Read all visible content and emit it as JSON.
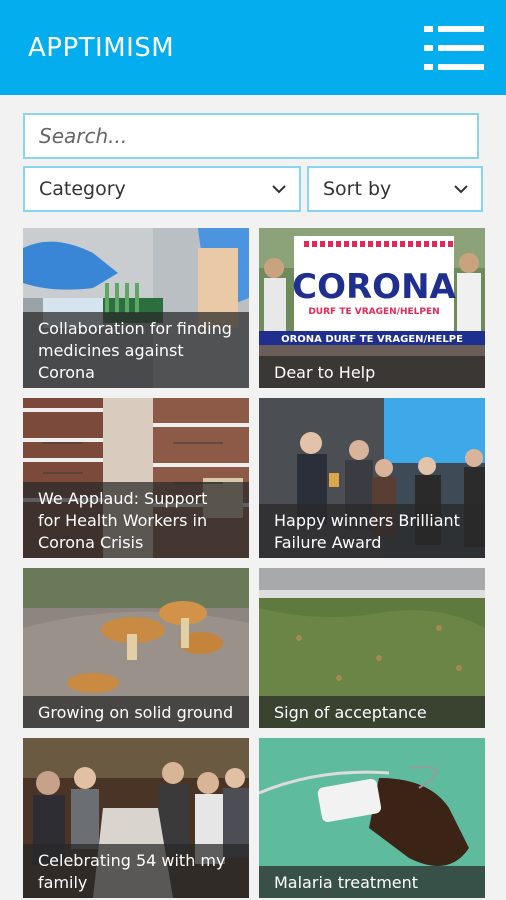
{
  "header": {
    "title": "APPTIMISM",
    "menu_icon": "hamburger-menu-icon",
    "color": "#03adee"
  },
  "search": {
    "placeholder": "Search..."
  },
  "filters": {
    "category_label": "Category",
    "sort_label": "Sort by"
  },
  "cards": [
    {
      "title": "Collaboration for finding medicines against Corona",
      "image": "lab-gloves-test-tubes"
    },
    {
      "title": "Dear to Help",
      "image": "corona-banner-crowd",
      "banner_title": "CORONA",
      "banner_sub": "DURF TE VRAGEN/HELPEN",
      "banner_strip": "ORONA DURF TE VRAGEN/HELPE"
    },
    {
      "title": "We Applaud: Support for Health Workers in Corona Crisis",
      "image": "apartment-balconies"
    },
    {
      "title": "Happy winners Brilliant Failure Award",
      "image": "award-ceremony-stage"
    },
    {
      "title": "Growing on solid ground",
      "image": "mushrooms-on-log"
    },
    {
      "title": "Sign of acceptance",
      "image": "grass-lawn"
    },
    {
      "title": "Celebrating 54 with my family",
      "image": "family-dinner"
    },
    {
      "title": "Malaria treatment",
      "image": "iv-drip-hand"
    }
  ]
}
